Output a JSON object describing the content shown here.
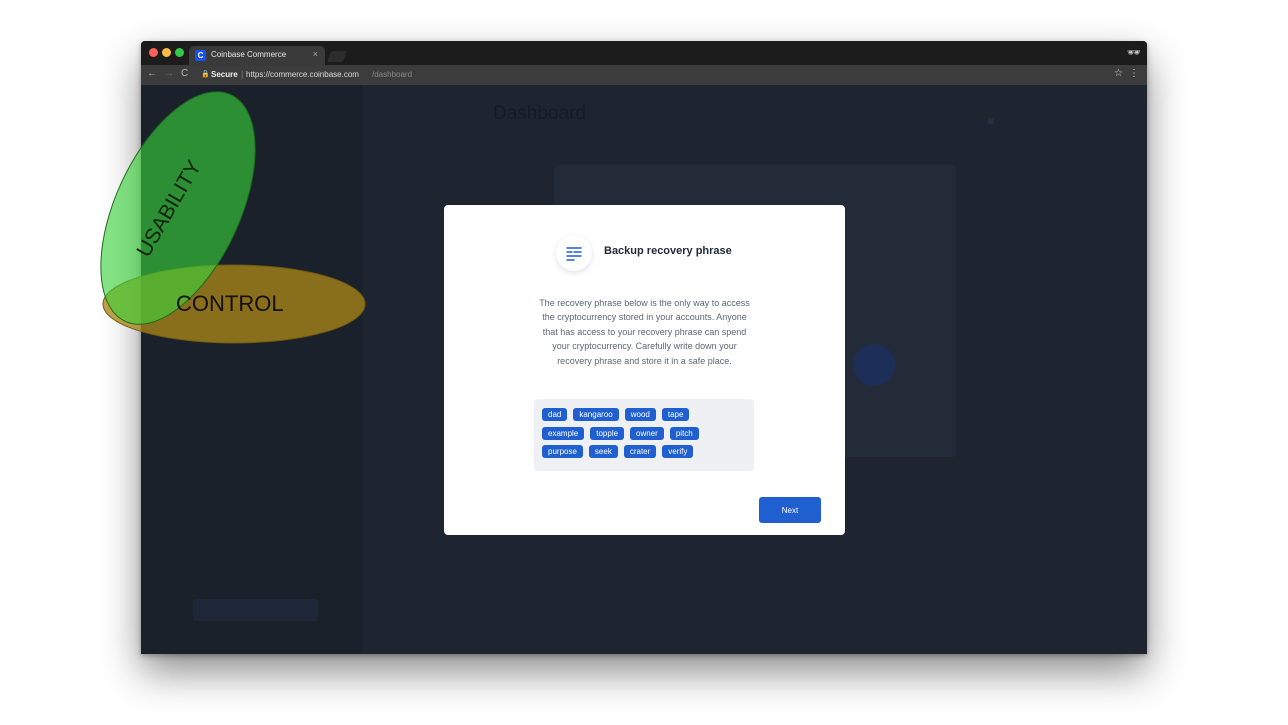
{
  "browser": {
    "tab_title": "Coinbase Commerce",
    "tab_favicon_letter": "C",
    "tab_close": "×",
    "secure_label": "Secure",
    "url_domain": "https://commerce.coinbase.com",
    "url_path": "/dashboard",
    "icons": {
      "back": "←",
      "forward": "→",
      "reload": "C",
      "lock": "🔒",
      "star": "☆",
      "menu": "⋮",
      "incognito": "🕶"
    }
  },
  "modal": {
    "title": "Backup recovery phrase",
    "description": "The recovery phrase below is the only way to access the cryptocurrency stored in your accounts. Anyone that has access to your recovery phrase can spend your cryptocurrency. Carefully write down your recovery phrase and store it in a safe place.",
    "words": [
      [
        "dad",
        "kangaroo",
        "wood",
        "tape"
      ],
      [
        "example",
        "topple",
        "owner",
        "pitch"
      ],
      [
        "purpose",
        "seek",
        "crater",
        "verify"
      ]
    ],
    "next_label": "Next"
  },
  "overlay": {
    "usability_label": "USABILITY",
    "control_label": "CONTROL",
    "usability_color": "#3ad43a",
    "control_color": "#a98517"
  },
  "colors": {
    "accent": "#1f5fcf",
    "app_background": "#1e2531",
    "tab_bar": "#1c1c1c"
  }
}
